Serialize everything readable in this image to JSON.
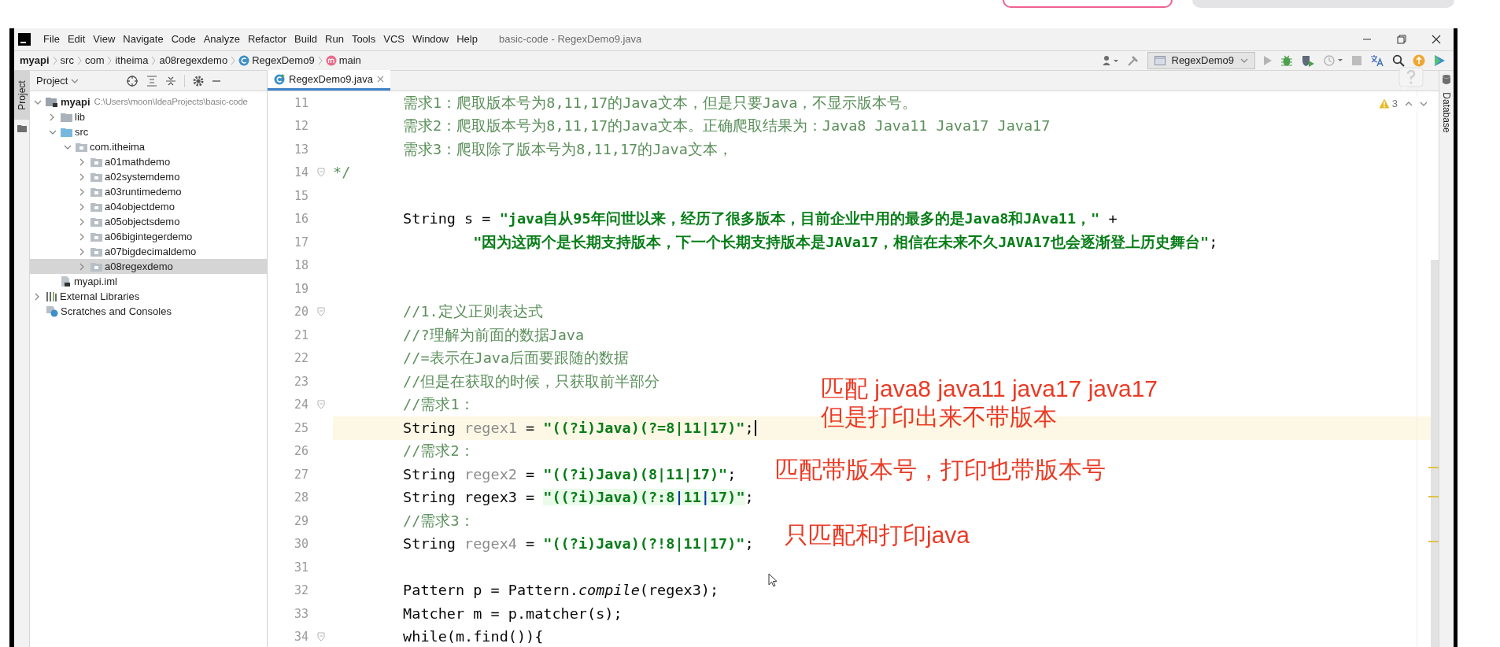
{
  "window": {
    "title": "basic-code - RegexDemo9.java"
  },
  "menu": [
    "File",
    "Edit",
    "View",
    "Navigate",
    "Code",
    "Analyze",
    "Refactor",
    "Build",
    "Run",
    "Tools",
    "VCS",
    "Window",
    "Help"
  ],
  "breadcrumbs": [
    {
      "label": "myapi",
      "kind": "project"
    },
    {
      "label": "src",
      "kind": "folder"
    },
    {
      "label": "com",
      "kind": "folder"
    },
    {
      "label": "itheima",
      "kind": "folder"
    },
    {
      "label": "a08regexdemo",
      "kind": "folder"
    },
    {
      "label": "RegexDemo9",
      "kind": "class"
    },
    {
      "label": "main",
      "kind": "method"
    }
  ],
  "run_config": {
    "label": "RegexDemo9"
  },
  "side_tabs": {
    "left": "Project",
    "right": "Database"
  },
  "project_panel": {
    "title": "Project",
    "tree": [
      {
        "label": "myapi",
        "path": "C:\\Users\\moon\\IdeaProjects\\basic-code",
        "kind": "module",
        "expanded": true,
        "selected": false,
        "children": [
          {
            "label": "lib",
            "kind": "folder",
            "expanded": false,
            "selected": false
          },
          {
            "label": "src",
            "kind": "source",
            "expanded": true,
            "selected": false,
            "children": [
              {
                "label": "com.itheima",
                "kind": "package",
                "expanded": true,
                "selected": false,
                "children": [
                  {
                    "label": "a01mathdemo",
                    "kind": "package",
                    "expanded": false,
                    "selected": false
                  },
                  {
                    "label": "a02systemdemo",
                    "kind": "package",
                    "expanded": false,
                    "selected": false
                  },
                  {
                    "label": "a03runtimedemo",
                    "kind": "package",
                    "expanded": false,
                    "selected": false
                  },
                  {
                    "label": "a04objectdemo",
                    "kind": "package",
                    "expanded": false,
                    "selected": false
                  },
                  {
                    "label": "a05objectsdemo",
                    "kind": "package",
                    "expanded": false,
                    "selected": false
                  },
                  {
                    "label": "a06bigintegerdemo",
                    "kind": "package",
                    "expanded": false,
                    "selected": false
                  },
                  {
                    "label": "a07bigdecimaldemo",
                    "kind": "package",
                    "expanded": false,
                    "selected": false
                  },
                  {
                    "label": "a08regexdemo",
                    "kind": "package",
                    "expanded": false,
                    "selected": true
                  }
                ]
              }
            ]
          },
          {
            "label": "myapi.iml",
            "kind": "file",
            "selected": false
          }
        ]
      },
      {
        "label": "External Libraries",
        "kind": "libraries",
        "expanded": false,
        "selected": false
      },
      {
        "label": "Scratches and Consoles",
        "kind": "scratches",
        "selected": false
      }
    ]
  },
  "editor": {
    "tabs": [
      {
        "label": "RegexDemo9.java",
        "selected": true
      }
    ],
    "warnings": "3",
    "lines": [
      {
        "number": "11",
        "fold": false,
        "current": false,
        "segments": [
          {
            "kind": "comment",
            "text": "        需求1：爬取版本号为8,11,17的Java文本，但是只要Java，不显示版本号。"
          }
        ]
      },
      {
        "number": "12",
        "fold": false,
        "current": false,
        "segments": [
          {
            "kind": "comment",
            "text": "        需求2：爬取版本号为8,11,17的Java文本。正确爬取结果为：Java8 Java11 Java17 Java17"
          }
        ]
      },
      {
        "number": "13",
        "fold": false,
        "current": false,
        "segments": [
          {
            "kind": "comment",
            "text": "        需求3：爬取除了版本号为8,11,17的Java文本，"
          }
        ]
      },
      {
        "number": "14",
        "fold": true,
        "current": false,
        "segments": [
          {
            "kind": "comment",
            "text": "*/"
          }
        ]
      },
      {
        "number": "15",
        "fold": false,
        "current": false
      },
      {
        "number": "16",
        "fold": false,
        "current": false,
        "segments": [
          {
            "kind": "plain",
            "text": "        String s = "
          },
          {
            "kind": "string",
            "text": "\"java自从95年问世以来，经历了很多版本，目前企业中用的最多的是Java8和JAva11，\""
          },
          {
            "kind": "plain",
            "text": " +"
          }
        ]
      },
      {
        "number": "17",
        "fold": false,
        "current": false,
        "segments": [
          {
            "kind": "string",
            "text": "                \"因为这两个是长期支持版本，下一个长期支持版本是JAVa17，相信在未来不久JAVA17也会逐渐登上历史舞台\""
          },
          {
            "kind": "plain",
            "text": ";"
          }
        ]
      },
      {
        "number": "18",
        "fold": false,
        "current": false
      },
      {
        "number": "19",
        "fold": false,
        "current": false
      },
      {
        "number": "20",
        "fold": true,
        "current": false,
        "segments": [
          {
            "kind": "comment",
            "text": "        //1.定义正则表达式"
          }
        ]
      },
      {
        "number": "21",
        "fold": false,
        "current": false,
        "segments": [
          {
            "kind": "comment",
            "text": "        //?理解为前面的数据Java"
          }
        ]
      },
      {
        "number": "22",
        "fold": false,
        "current": false,
        "segments": [
          {
            "kind": "comment",
            "text": "        //=表示在Java后面要跟随的数据"
          }
        ]
      },
      {
        "number": "23",
        "fold": false,
        "current": false,
        "segments": [
          {
            "kind": "comment",
            "text": "        //但是在获取的时候，只获取前半部分"
          }
        ]
      },
      {
        "number": "24",
        "fold": true,
        "current": false,
        "segments": [
          {
            "kind": "comment",
            "text": "        //需求1："
          }
        ]
      },
      {
        "number": "25",
        "fold": false,
        "current": true,
        "segments": [
          {
            "kind": "plain",
            "text": "        String "
          },
          {
            "kind": "unused",
            "text": "regex1"
          },
          {
            "kind": "plain",
            "text": " = "
          },
          {
            "kind": "string",
            "text": "\"((?i)Java)(?=8|11|17)\""
          },
          {
            "kind": "plain",
            "text": ";"
          }
        ]
      },
      {
        "number": "26",
        "fold": false,
        "current": false,
        "segments": [
          {
            "kind": "comment",
            "text": "        //需求2："
          }
        ]
      },
      {
        "number": "27",
        "fold": false,
        "current": false,
        "segments": [
          {
            "kind": "plain",
            "text": "        String "
          },
          {
            "kind": "unused",
            "text": "regex2"
          },
          {
            "kind": "plain",
            "text": " = "
          },
          {
            "kind": "string",
            "text": "\"((?i)Java)(8|11|17)\""
          },
          {
            "kind": "plain",
            "text": ";"
          }
        ]
      },
      {
        "number": "28",
        "fold": false,
        "current": false,
        "segments": [
          {
            "kind": "plain",
            "text": "        String regex3 = "
          },
          {
            "kind": "regex",
            "text": "\"((?i)Java)(?:8"
          },
          {
            "kind": "regex-bar",
            "text": "|"
          },
          {
            "kind": "regex",
            "text": "11"
          },
          {
            "kind": "regex-bar",
            "text": "|"
          },
          {
            "kind": "regex",
            "text": "17)\""
          },
          {
            "kind": "plain",
            "text": ";"
          }
        ]
      },
      {
        "number": "29",
        "fold": false,
        "current": false,
        "segments": [
          {
            "kind": "comment",
            "text": "        //需求3："
          }
        ]
      },
      {
        "number": "30",
        "fold": false,
        "current": false,
        "segments": [
          {
            "kind": "plain",
            "text": "        String "
          },
          {
            "kind": "unused",
            "text": "regex4"
          },
          {
            "kind": "plain",
            "text": " = "
          },
          {
            "kind": "string",
            "text": "\"((?i)Java)(?!8|11|17)\""
          },
          {
            "kind": "plain",
            "text": ";"
          }
        ]
      },
      {
        "number": "31",
        "fold": false,
        "current": false
      },
      {
        "number": "32",
        "fold": false,
        "current": false,
        "segments": [
          {
            "kind": "plain",
            "text": "        Pattern p = Pattern."
          },
          {
            "kind": "italic",
            "text": "compile"
          },
          {
            "kind": "plain",
            "text": "(regex3);"
          }
        ]
      },
      {
        "number": "33",
        "fold": false,
        "current": false,
        "segments": [
          {
            "kind": "plain",
            "text": "        Matcher m = p.matcher(s);"
          }
        ]
      },
      {
        "number": "34",
        "fold": true,
        "current": false,
        "segments": [
          {
            "kind": "plain",
            "text": "        while(m.find()){"
          }
        ]
      }
    ]
  },
  "annotations": [
    {
      "lines": [
        "匹配 java8 java11 java17 java17",
        "但是打印出来不带版本"
      ]
    },
    {
      "lines": [
        "匹配带版本号，打印也带版本号"
      ]
    },
    {
      "lines": [
        "只匹配和打印java"
      ]
    }
  ]
}
